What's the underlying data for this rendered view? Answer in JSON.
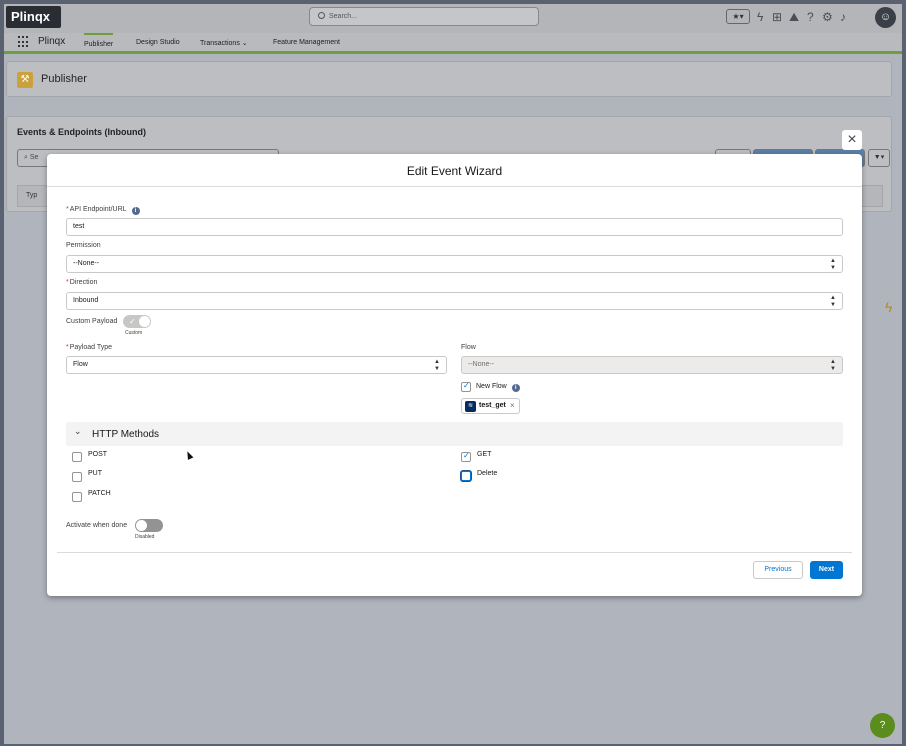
{
  "topbar": {
    "logo": "Plinqx",
    "search_placeholder": "Search...",
    "utility_icons": [
      "favorites-icon",
      "lightning-icon",
      "add-icon",
      "trailhead-icon",
      "help-icon",
      "setup-gear-icon",
      "notifications-bell-icon",
      "avatar"
    ]
  },
  "navbar": {
    "app_name": "Plinqx",
    "tabs": [
      {
        "label": "Publisher",
        "active": true
      },
      {
        "label": "Design Studio",
        "active": false
      },
      {
        "label": "Transactions",
        "active": false,
        "dropdown": true
      },
      {
        "label": "Feature Management",
        "active": false
      }
    ]
  },
  "page": {
    "header_title": "Publisher",
    "list_title": "Events & Endpoints (Inbound)",
    "list_search_placeholder": "Se",
    "list_first_column": "Typ"
  },
  "modal": {
    "title": "Edit Event Wizard",
    "close_glyph": "×",
    "api_endpoint": {
      "label": "API Endpoint/URL",
      "required": true,
      "value": "test"
    },
    "permission": {
      "label": "Permission",
      "value": "--None--"
    },
    "direction": {
      "label": "Direction",
      "required": true,
      "value": "Inbound"
    },
    "custom_payload": {
      "label": "Custom Payload",
      "state_label": "Custom",
      "checked": true
    },
    "payload_type": {
      "label": "Payload Type",
      "required": true,
      "value": "Flow"
    },
    "flow": {
      "label": "Flow",
      "value": "--None--",
      "disabled": true
    },
    "new_flow": {
      "label": "New Flow",
      "checked": true
    },
    "flow_pill": {
      "label": "test_get"
    },
    "http_section": {
      "title": "HTTP Methods",
      "methods": [
        {
          "label": "POST",
          "checked": false
        },
        {
          "label": "PUT",
          "checked": false
        },
        {
          "label": "PATCH",
          "checked": false
        },
        {
          "label": "GET",
          "checked": true
        },
        {
          "label": "Delete",
          "checked": false
        }
      ]
    },
    "activate": {
      "label": "Activate when done",
      "state_label": "Disabled",
      "checked": false
    },
    "buttons": {
      "previous": "Previous",
      "next": "Next"
    }
  },
  "colors": {
    "brand_blue": "#0176d3",
    "nav_accent_green": "#6f9e3a",
    "required_red": "#c23934"
  }
}
